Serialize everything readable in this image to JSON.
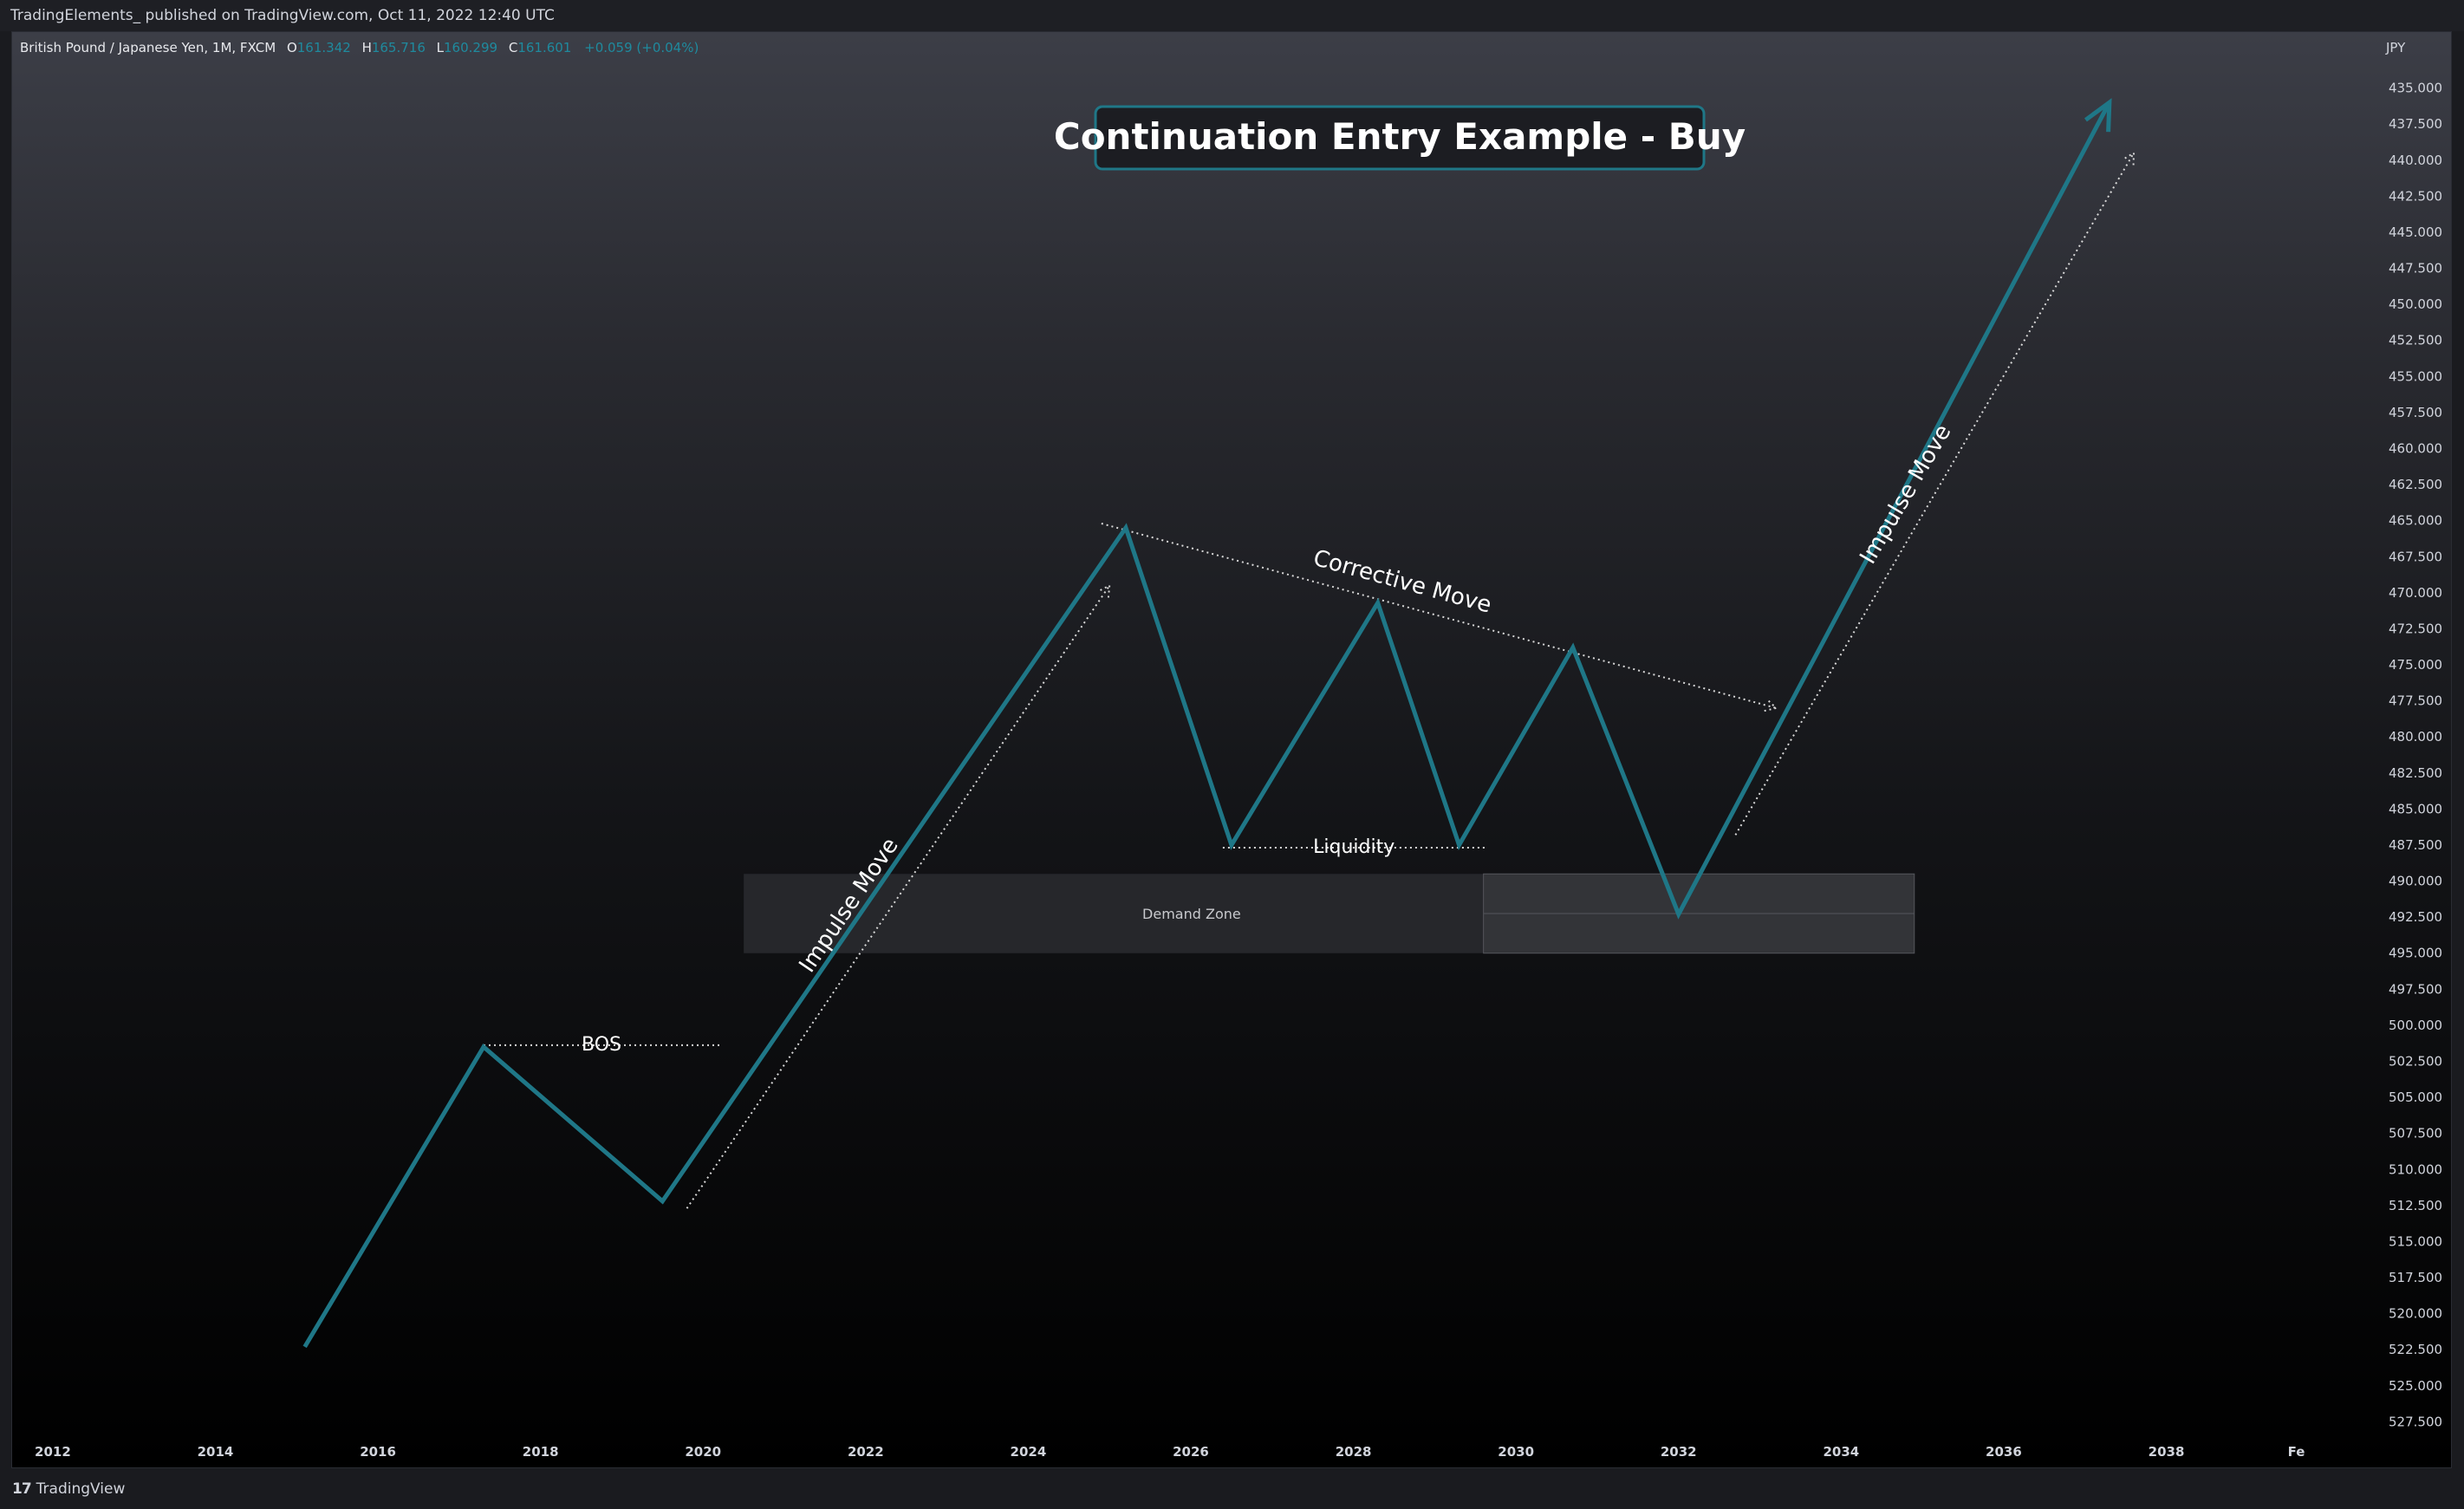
{
  "header": {
    "published_text": "TradingElements_ published on TradingView.com, Oct 11, 2022 12:40 UTC"
  },
  "legend": {
    "symbol": "British Pound / Japanese Yen, 1M, FXCM",
    "open_label": "O",
    "open": "161.342",
    "high_label": "H",
    "high": "165.716",
    "low_label": "L",
    "low": "160.299",
    "close_label": "C",
    "close": "161.601",
    "change": "+0.059 (+0.04%)"
  },
  "footer": {
    "brand": "TradingView"
  },
  "colors": {
    "accent": "#1f7787",
    "teal_text": "#1f8a9e",
    "zone": "#2a2b30",
    "background_top": "#3c3e47",
    "background_bottom": "#000000"
  },
  "chart_data": {
    "type": "line",
    "title": "Continuation Entry Example - Buy",
    "currency": "JPY",
    "y_inverted": true,
    "ylim": [
      432.5,
      530
    ],
    "xlim": [
      2011.5,
      2040.5
    ],
    "y_ticks": [
      "435.000",
      "437.500",
      "440.000",
      "442.500",
      "445.000",
      "447.500",
      "450.000",
      "452.500",
      "455.000",
      "457.500",
      "460.000",
      "462.500",
      "465.000",
      "467.500",
      "470.000",
      "472.500",
      "475.000",
      "477.500",
      "480.000",
      "482.500",
      "485.000",
      "487.500",
      "490.000",
      "492.500",
      "495.000",
      "497.500",
      "500.000",
      "502.500",
      "505.000",
      "507.500",
      "510.000",
      "512.500",
      "515.000",
      "517.500",
      "520.000",
      "522.500",
      "525.000",
      "527.500"
    ],
    "x_ticks": [
      "2012",
      "2014",
      "2016",
      "2018",
      "2020",
      "2022",
      "2024",
      "2026",
      "2028",
      "2030",
      "2032",
      "2034",
      "2036",
      "2038",
      "Fe"
    ],
    "series": [
      {
        "points": [
          [
            2015.1,
            522.3
          ],
          [
            2017.3,
            501.5
          ],
          [
            2019.5,
            512.2
          ],
          [
            2025.2,
            465.5
          ],
          [
            2026.5,
            487.5
          ],
          [
            2028.3,
            470.7
          ],
          [
            2029.3,
            487.5
          ],
          [
            2030.7,
            473.8
          ],
          [
            2032.0,
            492.3
          ],
          [
            2037.3,
            436.0
          ]
        ]
      }
    ],
    "demand_zone": {
      "label": "Demand Zone",
      "x": [
        2020.5,
        2034.9
      ],
      "y": [
        489.5,
        495.0
      ],
      "split_x": 2029.6
    },
    "annotations": {
      "bos": "BOS",
      "liquidity": "Liquidity",
      "corrective": "Corrective Move",
      "impulse_1": "Impulse Move",
      "impulse_2": "Impulse Move"
    }
  }
}
